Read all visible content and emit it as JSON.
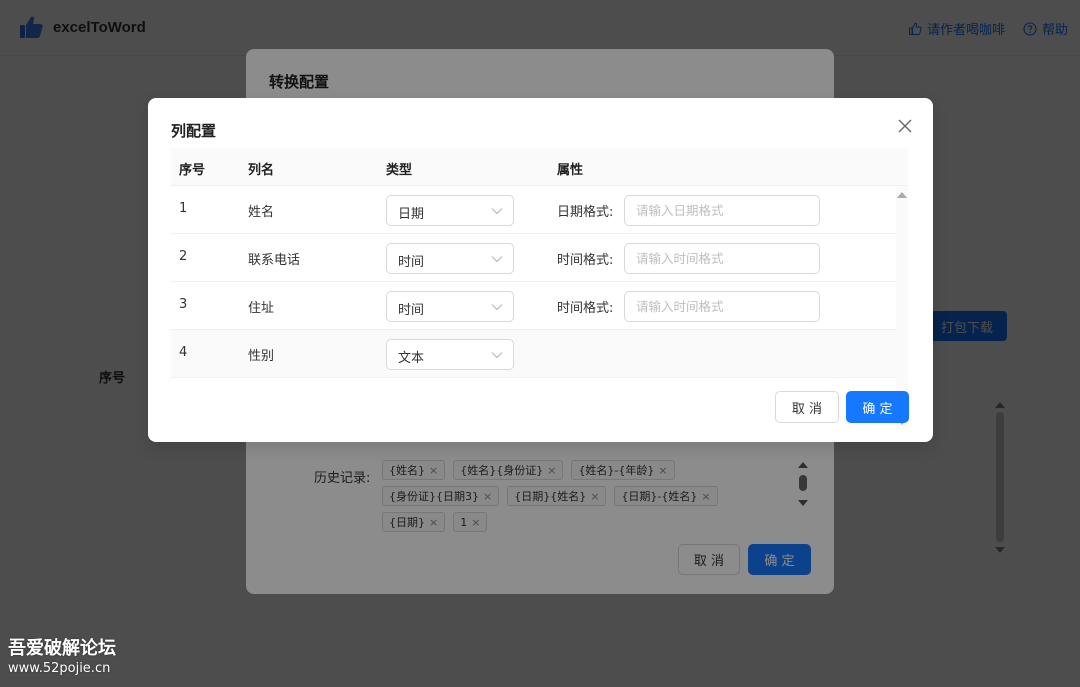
{
  "app": {
    "title": "excelToWord",
    "coffee_label": "请作者喝咖啡",
    "help_label": "帮助",
    "pack_download_label": "打包下载",
    "seq_label": "序号"
  },
  "convert_modal": {
    "title": "转换配置",
    "history_label": "历史记录:",
    "history": [
      "{姓名}",
      "{姓名}{身份证}",
      "{姓名}-{年龄}",
      "{身份证}{日期3}",
      "{日期}{姓名}",
      "{日期}-{姓名}",
      "{日期}",
      "1"
    ],
    "tag_close": "×",
    "cancel_label": "取 消",
    "ok_label": "确 定"
  },
  "column_modal": {
    "title": "列配置",
    "columns": {
      "index": "序号",
      "name": "列名",
      "type": "类型",
      "attr": "属性"
    },
    "rows": [
      {
        "index": "1",
        "name": "姓名",
        "type": "日期",
        "attr_label": "日期格式:",
        "attr_placeholder": "请输入日期格式"
      },
      {
        "index": "2",
        "name": "联系电话",
        "type": "时间",
        "attr_label": "时间格式:",
        "attr_placeholder": "请输入时间格式"
      },
      {
        "index": "3",
        "name": "住址",
        "type": "时间",
        "attr_label": "时间格式:",
        "attr_placeholder": "请输入时间格式"
      },
      {
        "index": "4",
        "name": "性别",
        "type": "文本",
        "attr_label": "",
        "attr_placeholder": ""
      }
    ],
    "cancel_label": "取 消",
    "ok_label": "确 定"
  },
  "watermark": {
    "line1": "吾爱破解论坛",
    "line2": "www.52pojie.cn"
  },
  "colors": {
    "primary": "#1677ff",
    "mask": "rgba(0,0,0,0.45)"
  }
}
